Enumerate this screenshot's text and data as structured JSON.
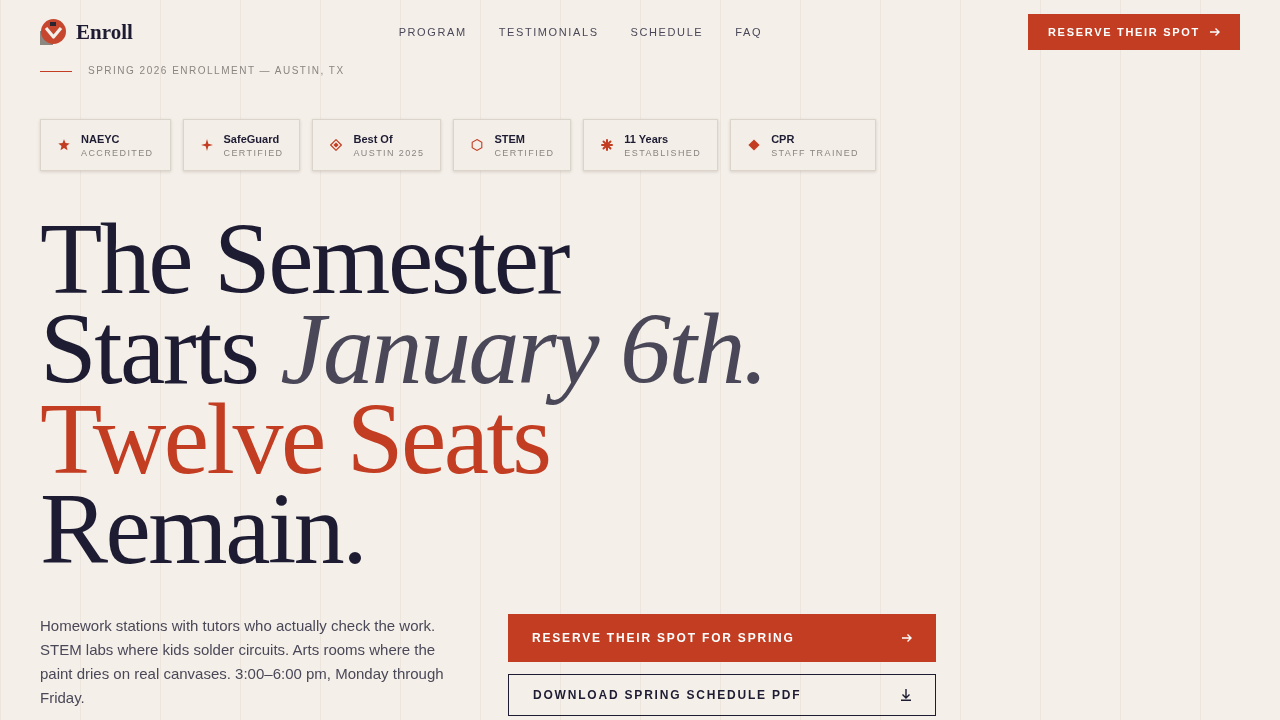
{
  "brand": {
    "name": "Enroll"
  },
  "nav": [
    {
      "label": "PROGRAM"
    },
    {
      "label": "TESTIMONIALS"
    },
    {
      "label": "SCHEDULE"
    },
    {
      "label": "FAQ"
    }
  ],
  "header_button": {
    "label": "RESERVE THEIR SPOT"
  },
  "eyebrow": "SPRING 2026 ENROLLMENT — AUSTIN, TX",
  "badges": [
    {
      "title": "NAEYC",
      "subtitle": "ACCREDITED"
    },
    {
      "title": "SafeGuard",
      "subtitle": "CERTIFIED"
    },
    {
      "title": "Best Of",
      "subtitle": "AUSTIN 2025"
    },
    {
      "title": "STEM",
      "subtitle": "CERTIFIED"
    },
    {
      "title": "11 Years",
      "subtitle": "ESTABLISHED"
    },
    {
      "title": "CPR",
      "subtitle": "STAFF TRAINED"
    }
  ],
  "headline": [
    {
      "text": "The Semester",
      "color": "#1e1c33"
    },
    {
      "text": "Starts *January 6th.*",
      "color": "#1e1c33"
    },
    {
      "text": "Twelve Seats",
      "color": "#c23d22"
    },
    {
      "text": "Remain.",
      "color": "#1e1c33"
    }
  ],
  "intro": "Homework stations with tutors who actually check the work. STEM labs where kids solder circuits. Arts rooms where the paint dries on real canvases. 3:00–6:00 pm, Monday through Friday.",
  "buttons": [
    {
      "label": "RESERVE THEIR SPOT FOR SPRING",
      "kind": "primary"
    },
    {
      "label": "DOWNLOAD SPRING SCHEDULE PDF",
      "kind": "outline"
    }
  ]
}
